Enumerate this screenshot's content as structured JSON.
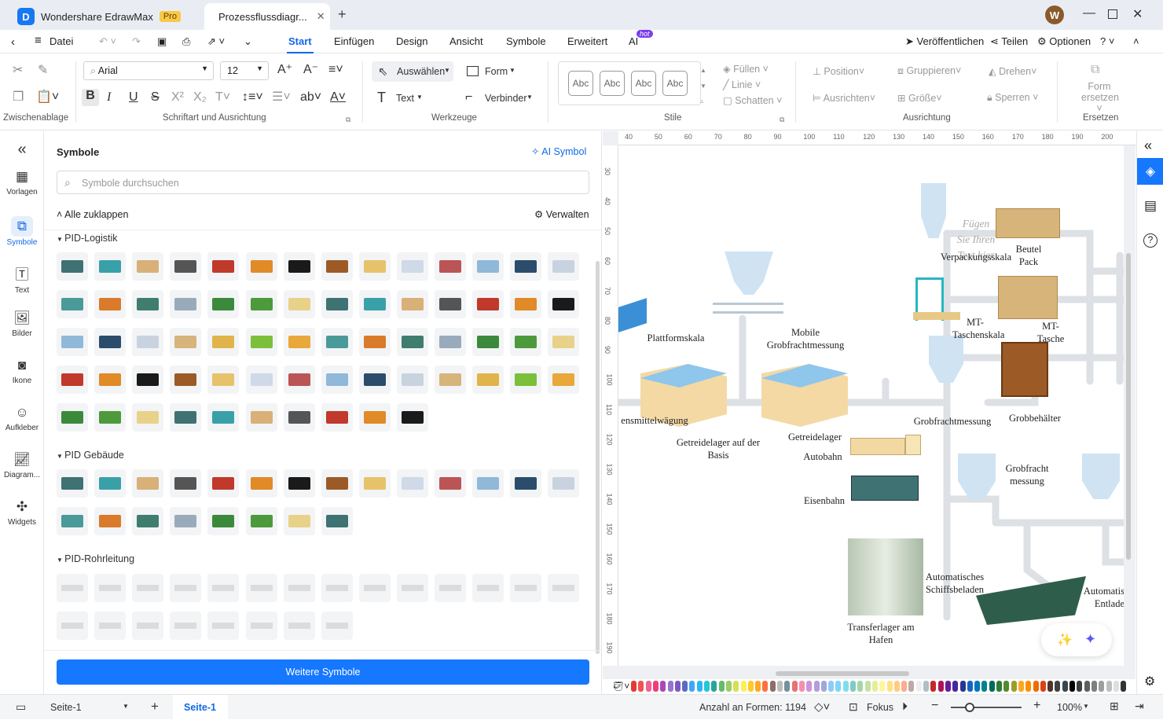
{
  "titlebar": {
    "app_tab": "Wondershare EdrawMax",
    "pro_badge": "Pro",
    "doc_tab": "Prozessflussdiagr...",
    "avatar": "W"
  },
  "menu": {
    "datei": "Datei",
    "items": [
      "Start",
      "Einfügen",
      "Design",
      "Ansicht",
      "Symbole",
      "Erweitert",
      "AI"
    ],
    "hot": "hot",
    "publish": "Veröffentlichen",
    "share": "Teilen",
    "options": "Optionen"
  },
  "ribbon": {
    "font": "Arial",
    "size": "12",
    "select": "Auswählen",
    "shape": "Form",
    "text": "Text",
    "connector": "Verbinder",
    "style_sample": "Abc",
    "fill": "Füllen",
    "line": "Linie",
    "shadow": "Schatten",
    "position": "Position",
    "group": "Gruppieren",
    "rotate": "Drehen",
    "align": "Ausrichten",
    "size_label": "Größe",
    "lock": "Sperren",
    "replace_line1": "Form",
    "replace_line2": "ersetzen",
    "groups": {
      "clipboard": "Zwischenablage",
      "font_align": "Schriftart und Ausrichtung",
      "tools": "Werkzeuge",
      "styles": "Stile",
      "arrange": "Ausrichtung",
      "replace": "Ersetzen"
    }
  },
  "leftnav": [
    "Vorlagen",
    "Symbole",
    "Text",
    "Bilder",
    "Ikone",
    "Aufkleber",
    "Diagram...",
    "Widgets"
  ],
  "panel": {
    "title": "Symbole",
    "ai_symbol": "AI Symbol",
    "search_placeholder": "Symbole durchsuchen",
    "collapse_all": "Alle zuklappen",
    "manage": "Verwalten",
    "sections": [
      "PID-Logistik",
      "PID Gebäude",
      "PID-Rohrleitung"
    ],
    "more_button": "Weitere Symbole"
  },
  "ruler": {
    "top": [
      "40",
      "50",
      "60",
      "70",
      "80",
      "90",
      "100",
      "110",
      "120",
      "130",
      "140",
      "150",
      "160",
      "170",
      "180",
      "190",
      "200"
    ],
    "left": [
      "30",
      "40",
      "50",
      "60",
      "70",
      "80",
      "90",
      "100",
      "110",
      "120",
      "130",
      "140",
      "150",
      "160",
      "170",
      "180",
      "190"
    ]
  },
  "canvas_labels": {
    "placeholder": "Fügen Sie Ihren Text hier",
    "verpackung": "Verpackungsskala",
    "beutel": "Beutel Pack",
    "plattform": "Plattformskala",
    "mobile": "Mobile Grobfrachtmessung",
    "mt_tasche": "MT-Taschenskala",
    "mt_tasche2": "MT-Tasche",
    "lebensmittel": "ensmittelwägung",
    "grobfracht": "Grobfrachtmessung",
    "grobbehaelter": "Grobbehälter",
    "getreide_basis": "Getreidelager auf der Basis",
    "getreide": "Getreidelager",
    "autobahn": "Autobahn",
    "grobfracht2": "Grobfracht messung",
    "eisenbahn": "Eisenbahn",
    "schiff": "Automatisches Schiffsbeladen",
    "entlade": "Automatis Entlade",
    "transfer": "Transferlager am Hafen"
  },
  "status": {
    "page_selector": "Seite-1",
    "page_tab": "Seite-1",
    "shape_count": "Anzahl an Formen: 1194",
    "focus": "Fokus",
    "zoom": "100%"
  },
  "palette": [
    "#e53935",
    "#ef5350",
    "#f06292",
    "#ec407a",
    "#ab47bc",
    "#9575cd",
    "#7e57c2",
    "#5c6bc0",
    "#42a5f5",
    "#29b6f6",
    "#26c6da",
    "#26a69a",
    "#66bb6a",
    "#9ccc65",
    "#d4e157",
    "#ffee58",
    "#ffca28",
    "#ffa726",
    "#ff7043",
    "#8d6e63",
    "#bdbdbd",
    "#78909c",
    "#e57373",
    "#f48fb1",
    "#ce93d8",
    "#b39ddb",
    "#9fa8da",
    "#90caf9",
    "#81d4fa",
    "#80deea",
    "#80cbc4",
    "#a5d6a7",
    "#c5e1a5",
    "#e6ee9c",
    "#fff59d",
    "#ffe082",
    "#ffcc80",
    "#ffab91",
    "#bcaaa4",
    "#eeeeee",
    "#b0bec5",
    "#c62828",
    "#ad1457",
    "#6a1b9a",
    "#4527a0",
    "#283593",
    "#1565c0",
    "#0277bd",
    "#00838f",
    "#00695c",
    "#2e7d32",
    "#558b2f",
    "#9e9d24",
    "#f9a825",
    "#ff8f00",
    "#ef6c00",
    "#d84315",
    "#4e342e",
    "#424242",
    "#37474f",
    "#000000",
    "#3e3e3e",
    "#5e5e5e",
    "#7e7e7e",
    "#9e9e9e",
    "#bebebe",
    "#dedede",
    "#333333"
  ]
}
